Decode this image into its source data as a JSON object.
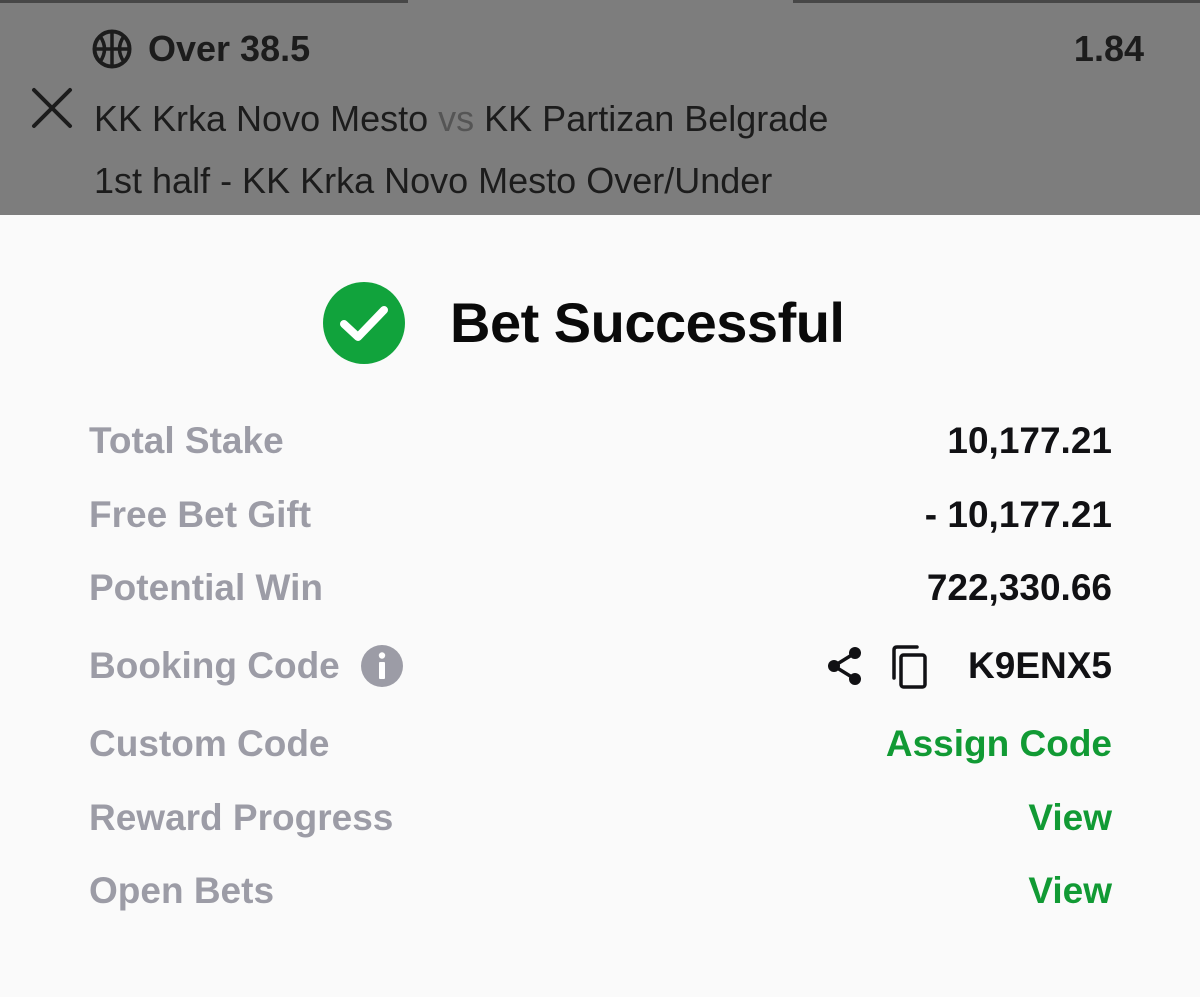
{
  "bet": {
    "sport_icon": "basketball-icon",
    "selection": "Over 38.5",
    "odds": "1.84",
    "home_team": "KK Krka Novo Mesto",
    "vs": "vs",
    "away_team": "KK Partizan Belgrade",
    "market": "1st half - KK Krka Novo Mesto Over/Under",
    "close_icon": "close-icon"
  },
  "result": {
    "icon": "check-circle-icon",
    "title": "Bet Successful",
    "accent_color": "#119a34"
  },
  "summary": {
    "total_stake_label": "Total Stake",
    "total_stake": "10,177.21",
    "free_bet_label": "Free Bet Gift",
    "free_bet": "- 10,177.21",
    "potential_win_label": "Potential Win",
    "potential_win": "722,330.66",
    "booking_code_label": "Booking Code",
    "booking_code": "K9ENX5",
    "custom_code_label": "Custom Code",
    "custom_code_action": "Assign Code",
    "reward_progress_label": "Reward Progress",
    "reward_progress_action": "View",
    "open_bets_label": "Open Bets",
    "open_bets_action": "View"
  }
}
